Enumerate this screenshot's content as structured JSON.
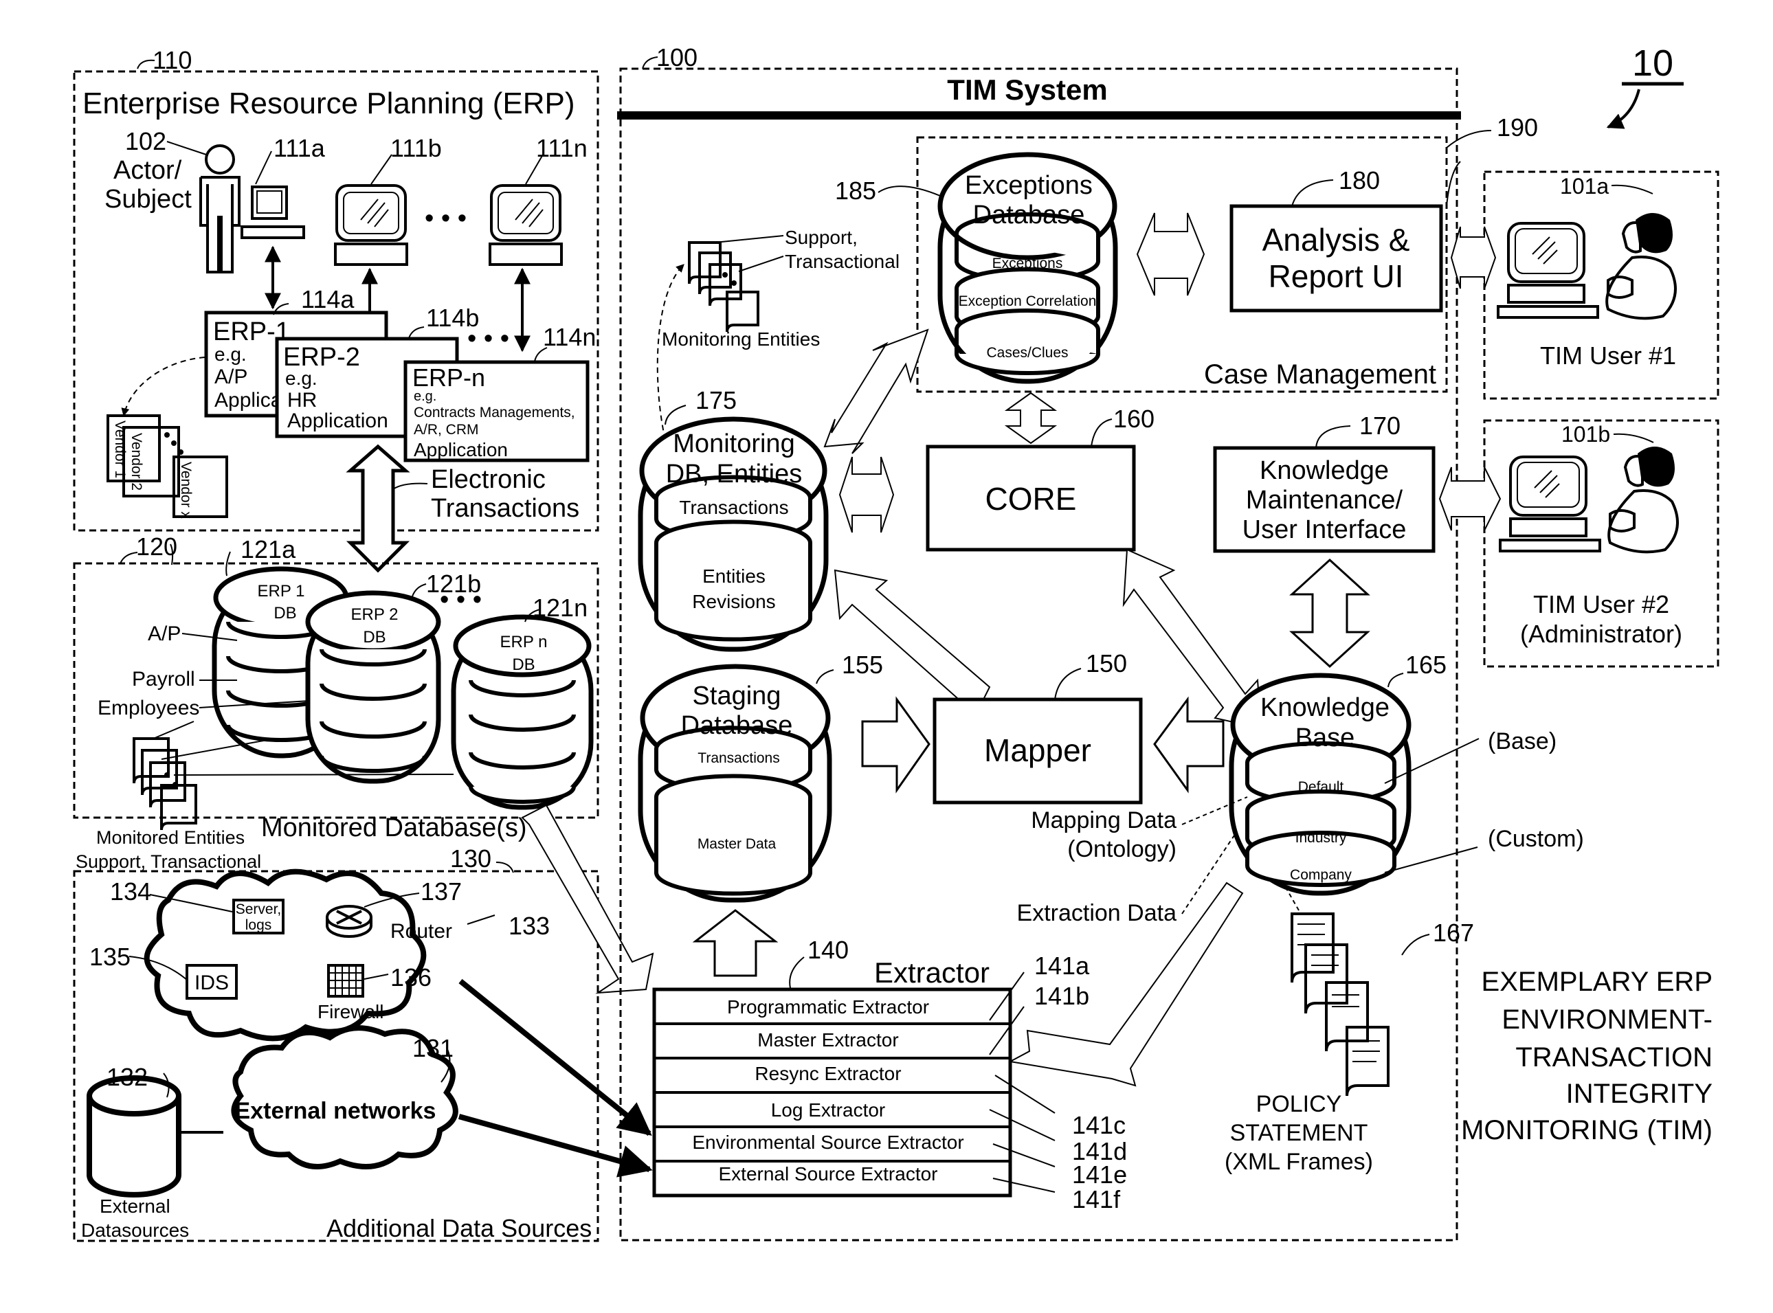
{
  "figure": {
    "number": "10",
    "caption_lines": [
      "EXEMPLARY ERP",
      "ENVIRONMENT-",
      "TRANSACTION",
      "INTEGRITY",
      "MONITORING (TIM)"
    ]
  },
  "erp": {
    "ref": "110",
    "title": "Enterprise Resource Planning (ERP)",
    "actor_ref": "102",
    "actor_label_lines": [
      "Actor/",
      "Subject"
    ],
    "terminals": [
      {
        "ref": "111a"
      },
      {
        "ref": "111b"
      },
      {
        "ref": "111n"
      }
    ],
    "apps": [
      {
        "ref": "114a",
        "name": "ERP-1",
        "lines": [
          "e.g.",
          "A/P",
          "Applica"
        ]
      },
      {
        "ref": "114b",
        "name": "ERP-2",
        "lines": [
          "e.g.",
          "HR",
          "Application"
        ]
      },
      {
        "ref": "114n",
        "name": "ERP-n",
        "lines": [
          "e.g.",
          "Contracts Managements,",
          "A/R, CRM",
          "Application"
        ]
      }
    ],
    "vendors": [
      "Vendor 1",
      "Vendor 2",
      "Vendor x"
    ],
    "ellipsis": "• • •",
    "transactions_label_lines": [
      "Electronic",
      "Transactions"
    ]
  },
  "monitored_db": {
    "ref": "120",
    "title": "Monitored Database(s)",
    "dbs": [
      {
        "ref": "121a",
        "lines": [
          "ERP 1",
          "DB"
        ]
      },
      {
        "ref": "121b",
        "lines": [
          "ERP 2",
          "DB"
        ]
      },
      {
        "ref": "121n",
        "lines": [
          "ERP n",
          "DB"
        ]
      }
    ],
    "table_labels": [
      "A/P",
      "Payroll",
      "Employees"
    ],
    "entities_label_lines": [
      "Monitored Entities",
      "Support, Transactional"
    ]
  },
  "additional": {
    "ref": "130",
    "title": "Additional Data Sources",
    "cloud_ref": "133",
    "server": {
      "ref": "134",
      "lines": [
        "Server,",
        "logs"
      ]
    },
    "ids": {
      "ref": "135",
      "label": "IDS"
    },
    "firewall": {
      "ref": "136",
      "label": "Firewall"
    },
    "router": {
      "ref": "137",
      "label": "Router"
    },
    "external_networks": {
      "ref": "131",
      "label": "External networks"
    },
    "external_ds": {
      "ref": "132",
      "lines": [
        "External",
        "Datasources"
      ]
    }
  },
  "tim": {
    "ref": "100",
    "title": "TIM System",
    "case_mgmt": {
      "ref": "190",
      "title": "Case Management"
    },
    "exceptions_db": {
      "ref": "185",
      "lines": [
        "Exceptions",
        "Database"
      ],
      "layers": [
        "Exceptions",
        "Exception Correlation",
        "Cases/Clues"
      ]
    },
    "analysis_ui": {
      "ref": "180",
      "lines": [
        "Analysis &",
        "Report UI"
      ]
    },
    "monitoring_entities": {
      "lines": [
        "Support,",
        "Transactional"
      ],
      "caption": "Monitoring Entities"
    },
    "monitoring_db": {
      "ref": "175",
      "lines": [
        "Monitoring",
        "DB, Entities"
      ],
      "layers": [
        "Transactions",
        "Entities",
        "Revisions"
      ]
    },
    "core": {
      "ref": "160",
      "label": "CORE"
    },
    "knowledge_ui": {
      "ref": "170",
      "lines": [
        "Knowledge",
        "Maintenance/",
        "User Interface"
      ]
    },
    "staging_db": {
      "ref": "155",
      "lines": [
        "Staging",
        "Database"
      ],
      "layers": [
        "Transactions",
        "Master Data"
      ]
    },
    "mapper": {
      "ref": "150",
      "label": "Mapper"
    },
    "knowledge_base": {
      "ref": "165",
      "lines": [
        "Knowledge",
        "Base"
      ],
      "layers": [
        "Default",
        "Industry",
        "Company"
      ],
      "base_label": "(Base)",
      "custom_label": "(Custom)"
    },
    "mapping_data_lines": [
      "Mapping Data",
      "(Ontology)"
    ],
    "extraction_data": "Extraction Data",
    "policy": {
      "ref": "167",
      "lines": [
        "POLICY",
        "STATEMENT",
        "(XML Frames)"
      ]
    },
    "extractor": {
      "ref": "140",
      "title": "Extractor",
      "rows": [
        {
          "ref": "141a",
          "label": "Programmatic Extractor"
        },
        {
          "ref": "141b",
          "label": "Master Extractor"
        },
        {
          "ref": "141c",
          "label": "Resync Extractor"
        },
        {
          "ref": "141d",
          "label": "Log Extractor"
        },
        {
          "ref": "141e",
          "label": "Environmental Source Extractor"
        },
        {
          "ref": "141f",
          "label": "External Source Extractor"
        }
      ]
    }
  },
  "users": [
    {
      "ref": "101a",
      "lines": [
        "TIM User #1"
      ]
    },
    {
      "ref": "101b",
      "lines": [
        "TIM User #2",
        "(Administrator)"
      ]
    }
  ]
}
